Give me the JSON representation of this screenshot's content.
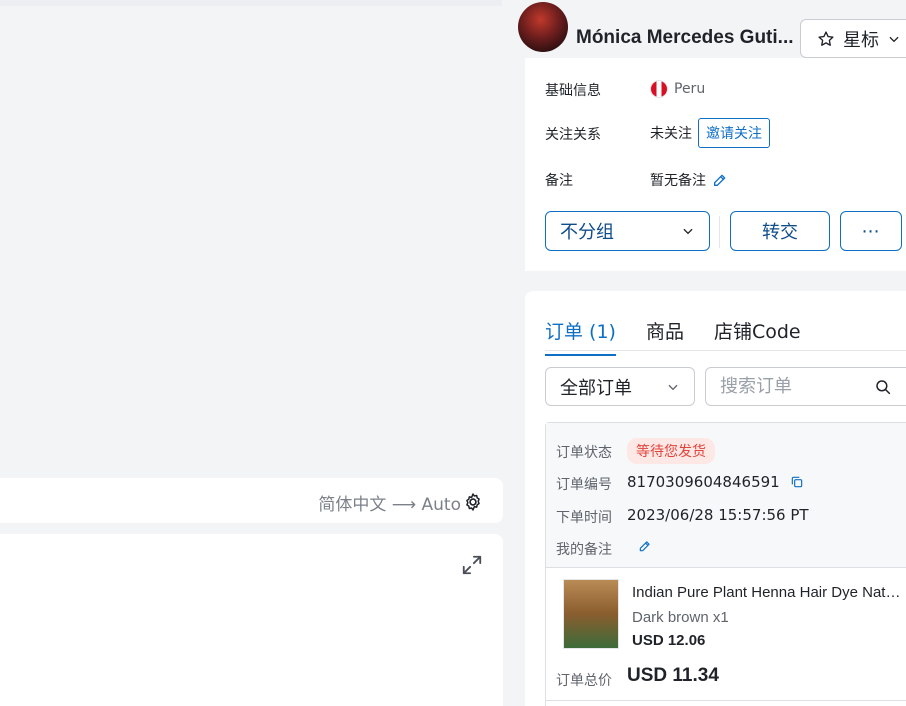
{
  "translation_bar": {
    "text": "简体中文 ⟶ Auto",
    "icon": "gear-icon"
  },
  "chat_panel": {
    "icon": "expand-icon"
  },
  "customer": {
    "name": "Mónica Mercedes Guti...",
    "star_label": "星标"
  },
  "info": {
    "basic_label": "基础信息",
    "country": "Peru",
    "follow_label": "关注关系",
    "follow_value": "未关注",
    "invite_label": "邀请关注",
    "remark_label": "备注",
    "remark_value": "暂无备注"
  },
  "actions": {
    "group_label": "不分组",
    "transfer_label": "转交",
    "more_label": "⋯"
  },
  "tabs": [
    {
      "label": "订单 (1)",
      "active": true
    },
    {
      "label": "商品",
      "active": false
    },
    {
      "label": "店铺Code",
      "active": false
    }
  ],
  "filter": {
    "selected": "全部订单",
    "search_placeholder": "搜索订单"
  },
  "order": {
    "status_label": "订单状态",
    "status_value": "等待您发货",
    "number_label": "订单编号",
    "number_value": "8170309604846591",
    "time_label": "下单时间",
    "time_value": "2023/06/28 15:57:56 PT",
    "note_label": "我的备注",
    "product_title": "Indian Pure Plant Henna Hair Dye Natural",
    "product_variant": "Dark brown x1",
    "product_price": "USD 12.06",
    "total_label": "订单总价",
    "total_value": "USD 11.34"
  },
  "colors": {
    "accent": "#0f6fc5",
    "status_text": "#e0443b",
    "status_bg": "#fde8e6"
  }
}
